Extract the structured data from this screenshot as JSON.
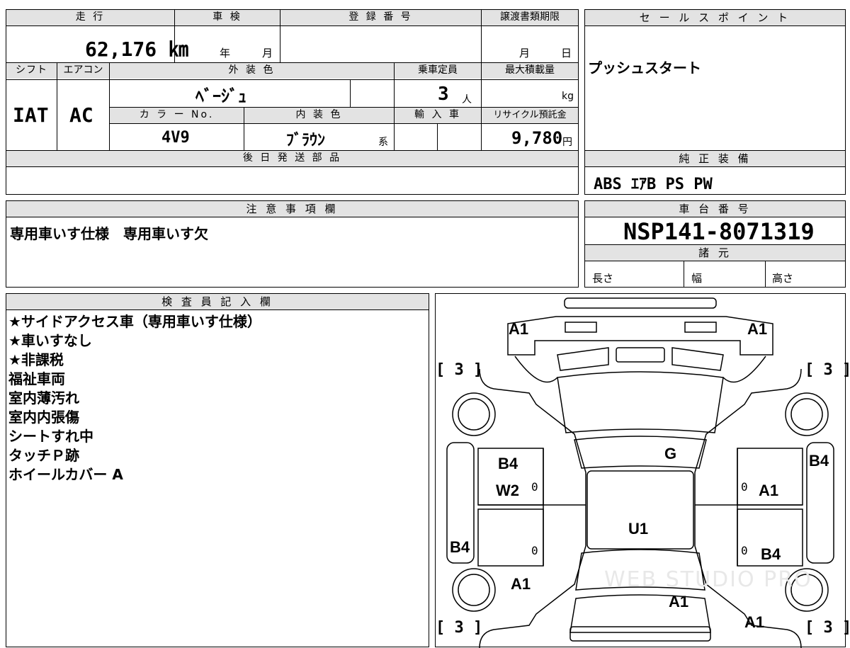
{
  "vehicle": {
    "mileage_label": "走 行",
    "mileage_value": "62,176 ㎞",
    "inspection_label": "車 検",
    "inspection_year": "年",
    "inspection_month": "月",
    "registration_label": "登 録 番 号",
    "transfer_label": "譲渡書類期限",
    "transfer_month": "月",
    "transfer_day": "日",
    "shift_label": "シフト",
    "shift_value": "IAT",
    "ac_label": "エアコン",
    "ac_value": "AC",
    "exterior_label": "外 装 色",
    "exterior_value": "ﾍﾞｰｼﾞｭ",
    "capacity_label": "乗車定員",
    "capacity_value": "3",
    "capacity_unit": "人",
    "maxload_label": "最大積載量",
    "maxload_unit": "kg",
    "color_no_label": "カ ラ ー No.",
    "color_no_value": "4V9",
    "interior_label": "内 装 色",
    "interior_value": "ﾌﾞﾗｳﾝ",
    "interior_suffix": "系",
    "import_label": "輸 入 車",
    "recycle_label": "リサイクル預託金",
    "recycle_value": "9,780",
    "recycle_unit": "円",
    "later_parts_label": "後 日 発 送 部 品"
  },
  "sales": {
    "label": "セ ー ル ス ポ イ ン ト",
    "text": "プッシュスタート"
  },
  "genuine": {
    "label": "純 正 装 備",
    "text": "ABS ｴｱB PS PW"
  },
  "notes": {
    "label": "注 意 事 項 欄",
    "text": "専用車いす仕様　専用車いす欠"
  },
  "chassis": {
    "label": "車 台 番 号",
    "value": "NSP141-8071319",
    "spec_label": "諸 元",
    "length": "長さ",
    "width": "幅",
    "height": "高さ"
  },
  "inspector": {
    "label": "検 査 員 記 入 欄",
    "lines": [
      "★サイドアクセス車（専用車いす仕様）",
      "★車いすなし",
      "★非課税",
      "福祉車両",
      "室内薄汚れ",
      "室内内張傷",
      "シートすれ中",
      "タッチＰ跡",
      "ホイールカバー A"
    ]
  },
  "diagram": {
    "marks": {
      "a1_front_left": "A1",
      "a1_front_right": "A1",
      "tire_fl": "[ 3 ]",
      "tire_fr": "[ 3 ]",
      "tire_rl": "[ 3 ]",
      "tire_rr": "[ 3 ]",
      "g_roof": "G",
      "b4_door_fl": "B4",
      "w2_door_fl": "W2",
      "b4_side_right": "B4",
      "a1_door_fr": "A1",
      "u1_center": "U1",
      "b4_side_left": "B4",
      "b4_door_rr": "B4",
      "a1_rear_left": "A1",
      "a1_rear_center": "A1",
      "a1_rear_right": "A1",
      "zero": "0"
    },
    "watermark": "WEB STUDIO PRO"
  }
}
